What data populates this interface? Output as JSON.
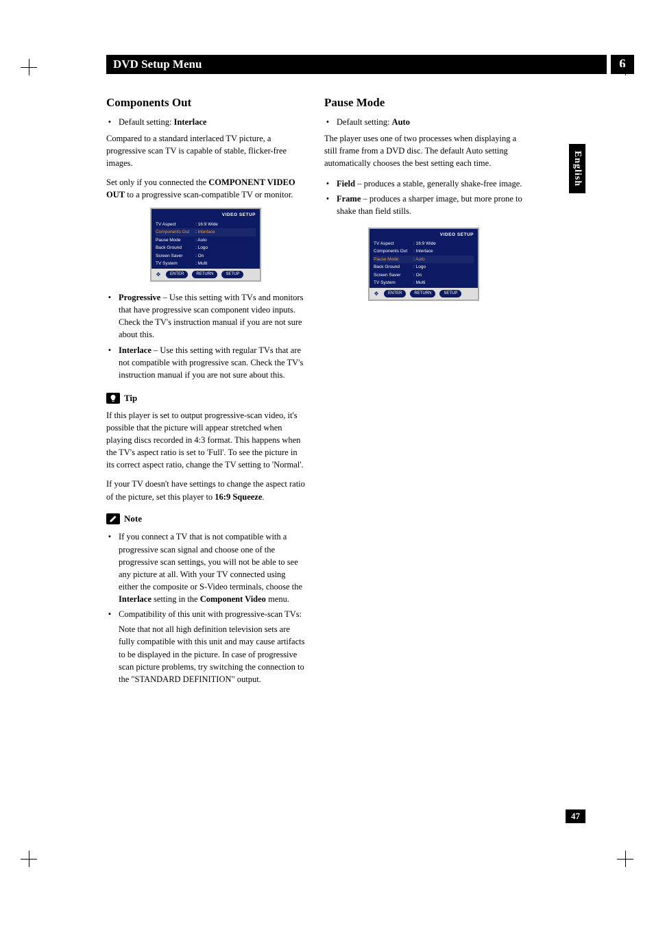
{
  "header": {
    "title": "DVD Setup Menu",
    "chapter_number": "6"
  },
  "language_tab": "English",
  "page_number": "47",
  "left": {
    "section_title": "Components Out",
    "default_label": "Default setting:",
    "default_value": "Interlace",
    "para1": "Compared to a standard interlaced TV picture, a progressive scan TV is capable of stable, flicker-free images.",
    "para2_pre": "Set only if you connected the ",
    "para2_bold": "COMPONENT VIDEO OUT",
    "para2_post": " to a progressive scan-compatible TV or monitor.",
    "osd": {
      "title": "VIDEO SETUP",
      "rows": [
        {
          "k": "TV Aspect",
          "v": "16:9 Wide",
          "hl": false
        },
        {
          "k": "Components Out",
          "v": "Interlace",
          "hl": true
        },
        {
          "k": "Pause Mode",
          "v": "Auto",
          "hl": false
        },
        {
          "k": "Back Ground",
          "v": "Logo",
          "hl": false
        },
        {
          "k": "Screen Saver",
          "v": "On",
          "hl": false
        },
        {
          "k": "TV System",
          "v": "Multi",
          "hl": false
        }
      ],
      "footer": [
        "ENTER",
        "RETURN",
        "SETUP"
      ]
    },
    "options": [
      {
        "bold": "Progressive",
        "text": " – Use this setting with TVs and monitors that have progressive scan component video inputs. Check the TV's instruction manual if you are not sure about this."
      },
      {
        "bold": "Interlace",
        "text": " – Use this setting with regular TVs that are not compatible with progressive scan. Check the TV's instruction manual if you are not sure about this."
      }
    ],
    "tip_label": "Tip",
    "tip_para1": "If this player is set to output progressive-scan video, it's possible that the picture will appear stretched when playing discs recorded in 4:3 format. This happens when the TV's aspect ratio is set to 'Full'. To see the picture in its correct aspect ratio, change the TV setting to 'Normal'.",
    "tip_para2_pre": "If your TV doesn't have settings to change the aspect ratio of the picture, set this player to ",
    "tip_para2_bold": "16:9 Squeeze",
    "tip_para2_post": ".",
    "note_label": "Note",
    "notes": [
      {
        "pre": "If you connect a TV that is not compatible with a progressive scan signal and choose one of the progressive scan settings, you will not be able to see any picture at all. With your TV connected using either the composite or S-Video terminals, choose the ",
        "bold1": "Interlace",
        "mid": " setting in the ",
        "bold2": "Component Video",
        "post": " menu."
      },
      {
        "pre": "Compatibility of this unit with progressive-scan TVs:",
        "sub": "Note that not all high definition television sets are fully compatible with this unit and may cause artifacts to be displayed in the picture. In case of progressive scan picture problems, try switching the connection to the \"STANDARD DEFINITION\" output."
      }
    ]
  },
  "right": {
    "section_title": "Pause Mode",
    "default_label": "Default setting:",
    "default_value": "Auto",
    "para1": "The player uses one of two processes when displaying a still frame from a DVD disc. The default Auto setting automatically chooses the best setting each time.",
    "options": [
      {
        "bold": "Field",
        "text": " – produces a stable, generally shake-free image."
      },
      {
        "bold": "Frame",
        "text": " – produces a sharper image, but more prone to shake than field stills."
      }
    ],
    "osd": {
      "title": "VIDEO SETUP",
      "rows": [
        {
          "k": "TV Aspect",
          "v": "16:9 Wide",
          "hl": false
        },
        {
          "k": "Components Out",
          "v": "Interlace",
          "hl": false
        },
        {
          "k": "Pause Mode",
          "v": "Auto",
          "hl": true
        },
        {
          "k": "Back Ground",
          "v": "Logo",
          "hl": false
        },
        {
          "k": "Screen Saver",
          "v": "On",
          "hl": false
        },
        {
          "k": "TV System",
          "v": "Multi",
          "hl": false
        }
      ],
      "footer": [
        "ENTER",
        "RETURN",
        "SETUP"
      ]
    }
  }
}
